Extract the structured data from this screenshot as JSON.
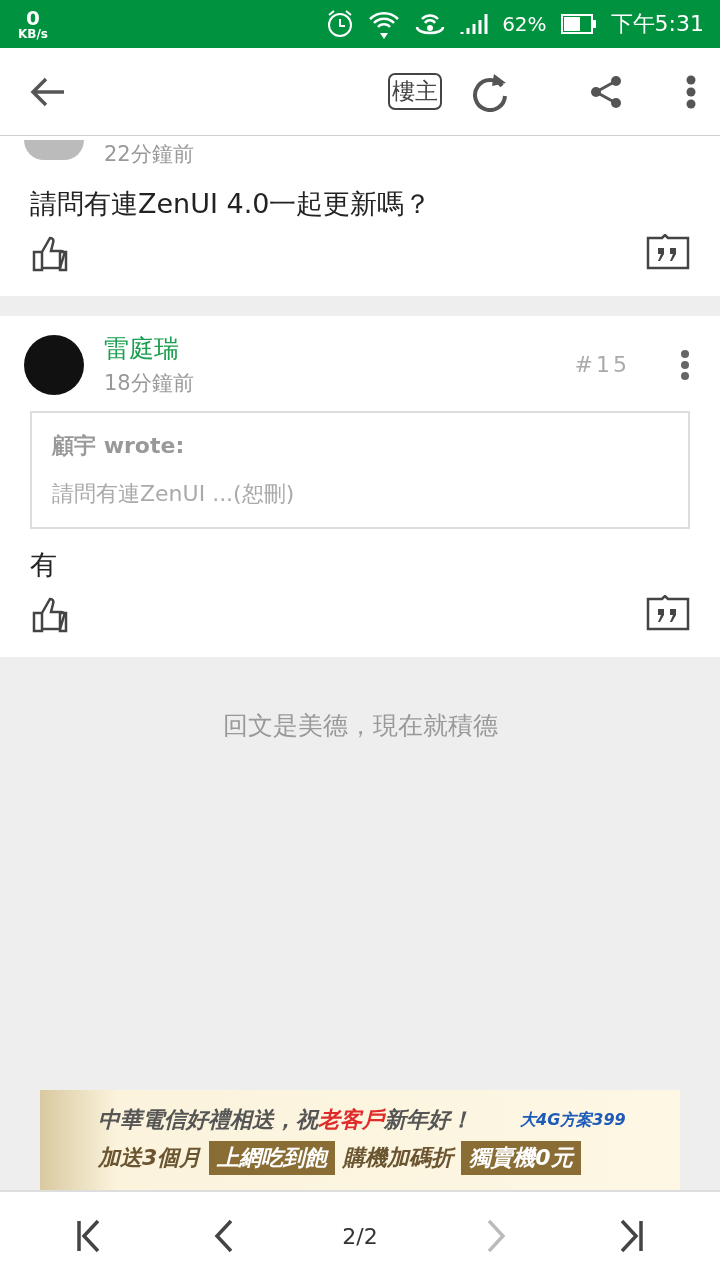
{
  "status_bar": {
    "speed": "0",
    "speed_unit": "KB/s",
    "battery": "62%",
    "time": "下午5:31"
  },
  "toolbar": {
    "op_label": "樓主"
  },
  "posts": [
    {
      "time": "22分鐘前",
      "body": "請問有連ZenUI 4.0一起更新嗎？",
      "partial": true
    },
    {
      "name": "雷庭瑞",
      "time": "18分鐘前",
      "floor": "#15",
      "quote": {
        "author": "顧宇 wrote:",
        "text": "請問有連ZenUI ...(恕刪)"
      },
      "body": "有",
      "partial": false
    }
  ],
  "reply_prompt": "回文是美德，現在就積德",
  "ad": {
    "line1": [
      {
        "text": "中華電信好禮相送，祝",
        "highlight": false
      },
      {
        "text": "老客戶",
        "highlight": true
      },
      {
        "text": "新年好！",
        "highlight": false
      }
    ],
    "logo": "大4G方案399",
    "line2": [
      {
        "text": "加送3個月",
        "kind": "plain"
      },
      {
        "text": "上網吃到飽",
        "kind": "badge"
      },
      {
        "text": "購機加碼折",
        "kind": "plain"
      },
      {
        "text": "獨賣機0元",
        "kind": "badge"
      }
    ]
  },
  "pager": {
    "page": "2/2",
    "prev_disabled": false,
    "next_disabled": true
  }
}
